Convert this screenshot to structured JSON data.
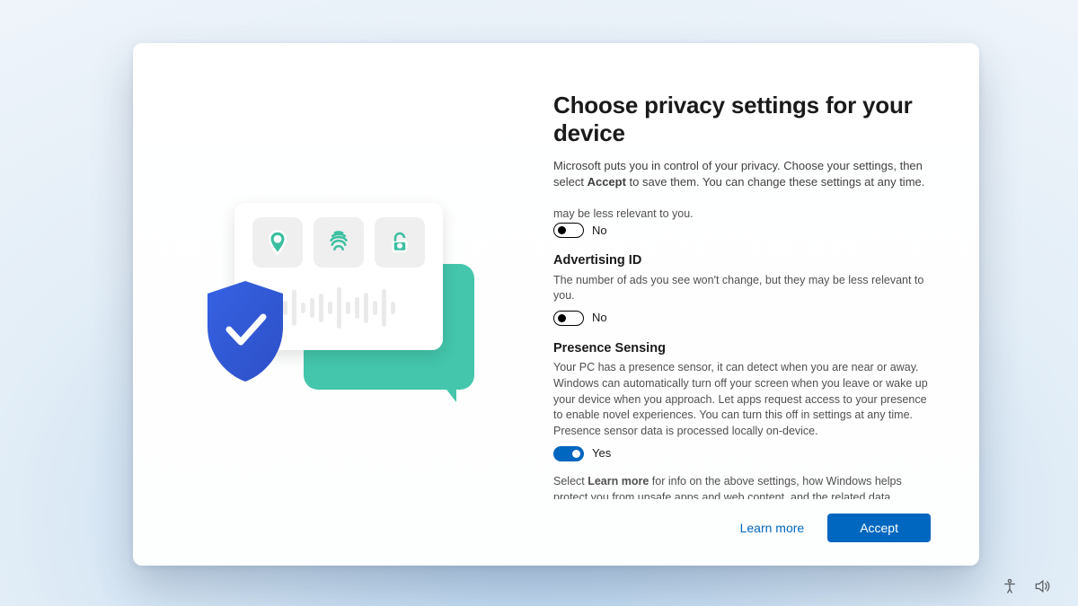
{
  "title": "Choose privacy settings for your device",
  "intro_pre": "Microsoft puts you in control of your privacy. Choose your settings, then select ",
  "intro_bold": "Accept",
  "intro_post": " to save them. You can change these settings at any time.",
  "partial_setting": {
    "desc": "may be less relevant to you.",
    "state_label": "No",
    "state_on": false
  },
  "settings": [
    {
      "title": "Advertising ID",
      "desc": "The number of ads you see won't change, but they may be less relevant to you.",
      "state_label": "No",
      "state_on": false
    },
    {
      "title": "Presence Sensing",
      "desc": "Your PC has a presence sensor, it can detect when you are near or away. Windows can automatically turn off your screen when you leave or wake up your device when you approach. Let apps request access to your presence to enable novel experiences. You can turn this off in settings at any time. Presence sensor data is processed locally on-device.",
      "state_label": "Yes",
      "state_on": true
    }
  ],
  "footnote_pre": "Select ",
  "footnote_bold": "Learn more",
  "footnote_post": " for info on the above settings, how Windows helps protect you from unsafe apps and web content, and the related data transfers and uses.",
  "buttons": {
    "learn": "Learn more",
    "accept": "Accept"
  },
  "colors": {
    "accent": "#0067c0",
    "teal": "#3bbfa1"
  },
  "wave_heights": [
    16,
    40,
    12,
    22,
    32,
    14,
    46,
    14,
    24,
    34,
    16,
    42,
    14
  ]
}
